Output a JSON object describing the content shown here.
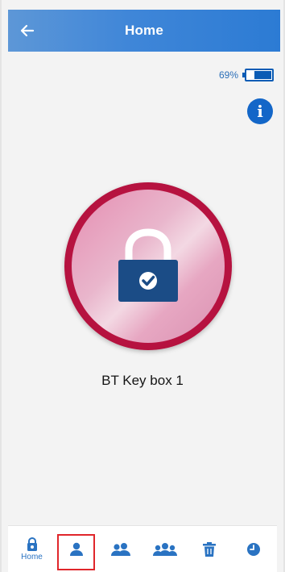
{
  "header": {
    "title": "Home",
    "back_icon": "back-arrow-icon"
  },
  "battery": {
    "text": "69%",
    "level": 0.69,
    "icon": "battery-icon"
  },
  "info": {
    "icon": "info-icon",
    "glyph": "i"
  },
  "device": {
    "name": "BT Key box 1",
    "status_icon": "padlock-locked-check-icon"
  },
  "colors": {
    "header_blue": "#3f86d8",
    "accent_blue": "#1366c8",
    "lock_ring": "#b5123f",
    "lock_body": "#1b4c86",
    "selected_outline": "#e0262b"
  },
  "nav": {
    "items": [
      {
        "id": "home",
        "label": "Home",
        "icon": "lock-home-icon"
      },
      {
        "id": "user",
        "label": "",
        "icon": "user-icon",
        "selected": true
      },
      {
        "id": "two-users",
        "label": "",
        "icon": "two-users-icon"
      },
      {
        "id": "group",
        "label": "",
        "icon": "group-icon"
      },
      {
        "id": "trash",
        "label": "",
        "icon": "trash-icon"
      },
      {
        "id": "history",
        "label": "",
        "icon": "clock-icon"
      }
    ]
  }
}
